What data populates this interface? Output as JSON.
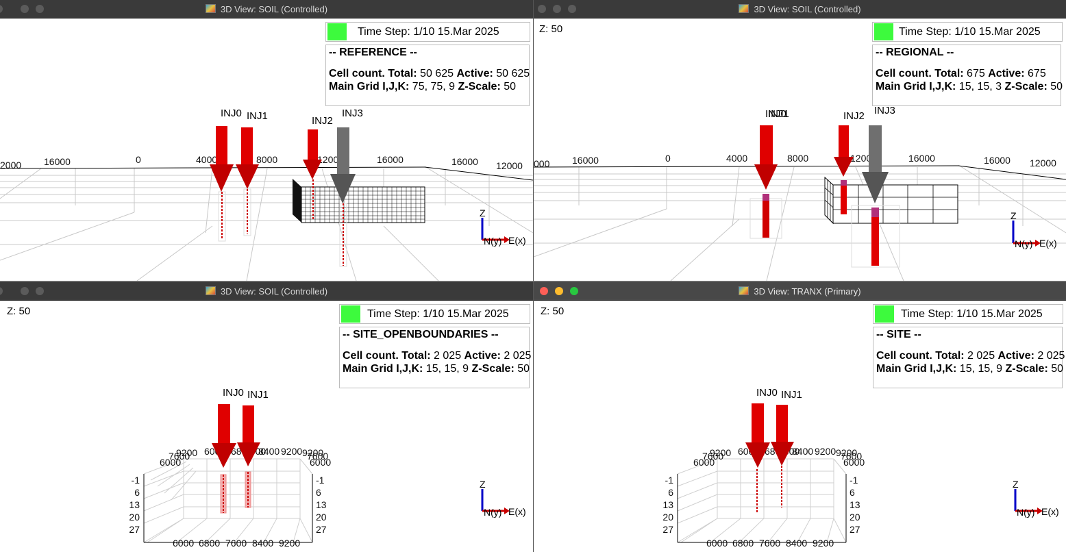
{
  "windows": [
    {
      "title": "3D View: SOIL (Controlled)",
      "z_label": "",
      "time_step": "Time Step: 1/10 15.Mar 2025",
      "case_name": "-- REFERENCE --",
      "cell_count_label": "Cell count. Total:",
      "cell_total": "50 625",
      "active_label": "Active:",
      "cell_active": "50 625",
      "grid_label": "Main Grid I,J,K:",
      "grid_dims": "75, 75, 9",
      "zscale_label": "Z-Scale:",
      "zscale": "50",
      "ticks": [
        "2000",
        "16000",
        "0",
        "4000",
        "8000",
        "12000",
        "16000",
        "16000",
        "12000"
      ],
      "wells": [
        "INJ0",
        "INJ1",
        "INJ2",
        "INJ3"
      ],
      "axis_z": "Z",
      "axis_n": "N(y)",
      "axis_e": "E(x)"
    },
    {
      "title": "3D View: SOIL (Controlled)",
      "z_label": "Z: 50",
      "time_step": "Time Step: 1/10 15.Mar 2025",
      "case_name": "-- REGIONAL --",
      "cell_count_label": "Cell count. Total:",
      "cell_total": "675",
      "active_label": "Active:",
      "cell_active": "675",
      "grid_label": "Main Grid I,J,K:",
      "grid_dims": "15, 15, 3",
      "zscale_label": "Z-Scale:",
      "zscale": "50",
      "ticks": [
        "000",
        "16000",
        "0",
        "4000",
        "8000",
        "12000",
        "16000",
        "16000",
        "12000"
      ],
      "wells": [
        "INJ0",
        "INJ1",
        "INJ2",
        "INJ3"
      ],
      "axis_z": "Z",
      "axis_n": "N(y)",
      "axis_e": "E(x)"
    },
    {
      "title": "3D View: SOIL (Controlled)",
      "z_label": "Z: 50",
      "time_step": "Time Step: 1/10 15.Mar 2025",
      "case_name": "-- SITE_OPENBOUNDARIES --",
      "cell_count_label": "Cell count. Total:",
      "cell_total": "2 025",
      "active_label": "Active:",
      "cell_active": "2 025",
      "grid_label": "Main Grid I,J,K:",
      "grid_dims": "15, 15, 9",
      "zscale_label": "Z-Scale:",
      "zscale": "50",
      "ticks_top": [
        "6000",
        "6800",
        "7600",
        "8400",
        "9200"
      ],
      "ticks_bottom": [
        "6000",
        "6800",
        "7600",
        "8400",
        "9200"
      ],
      "ticks_depth": [
        "-1",
        "6",
        "13",
        "20",
        "27"
      ],
      "wells": [
        "INJ0",
        "INJ1"
      ],
      "axis_z": "Z",
      "axis_n": "N(y)",
      "axis_e": "E(x)"
    },
    {
      "title": "3D View: TRANX (Primary)",
      "z_label": "Z: 50",
      "time_step": "Time Step: 1/10 15.Mar 2025",
      "case_name": "-- SITE --",
      "cell_count_label": "Cell count. Total:",
      "cell_total": "2 025",
      "active_label": "Active:",
      "cell_active": "2 025",
      "grid_label": "Main Grid I,J,K:",
      "grid_dims": "15, 15, 9",
      "zscale_label": "Z-Scale:",
      "zscale": "50",
      "ticks_top": [
        "6000",
        "6800",
        "7600",
        "8400",
        "9200"
      ],
      "ticks_bottom": [
        "6000",
        "6800",
        "7600",
        "8400",
        "9200"
      ],
      "ticks_depth": [
        "-1",
        "6",
        "13",
        "20",
        "27"
      ],
      "wells": [
        "INJ0",
        "INJ1"
      ],
      "axis_z": "Z",
      "axis_n": "N(y)",
      "axis_e": "E(x)"
    }
  ],
  "colors": {
    "injector_active": "#e00000",
    "injector_inactive": "#777777",
    "timestep_swatch": "#3dfa3d",
    "titlebar": "#3a3a3a"
  }
}
